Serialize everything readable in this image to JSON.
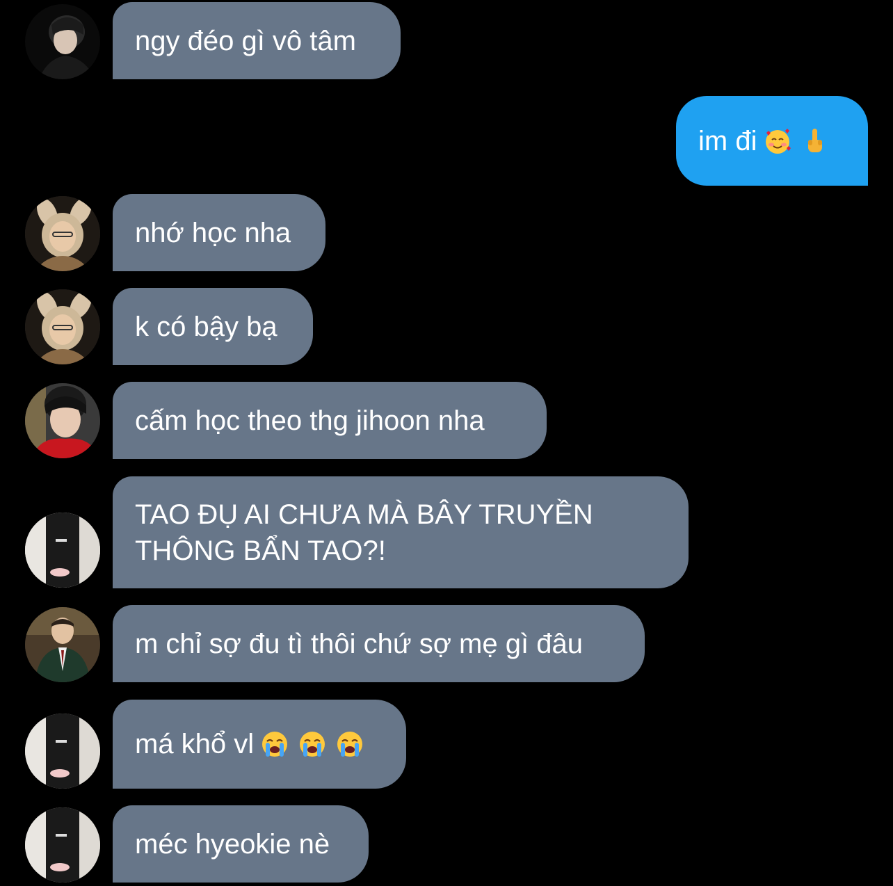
{
  "colors": {
    "background": "#000000",
    "incoming_bubble": "#677689",
    "outgoing_bubble": "#1fa1f1",
    "text": "#ffffff"
  },
  "messages": [
    {
      "direction": "in",
      "avatar": "avatar-glasses-profile",
      "text": "ngy đéo gì vô tâm"
    },
    {
      "direction": "out",
      "text": "im đi",
      "emojis": [
        "smiling-face-with-hearts-emoji",
        "middle-finger-emoji"
      ]
    },
    {
      "direction": "in",
      "avatar": "avatar-bunny-ears",
      "text": "nhớ học nha"
    },
    {
      "direction": "in",
      "avatar": "avatar-bunny-ears",
      "text": "k có bậy bạ"
    },
    {
      "direction": "in",
      "avatar": "avatar-red-scarf",
      "text": "cấm học theo thg jihoon nha"
    },
    {
      "direction": "in",
      "avatar": "avatar-white-jacket",
      "lines": [
        "TAO ĐỤ AI CHƯA MÀ BÂY TRUYỀN",
        "THÔNG BẨN TAO?!"
      ]
    },
    {
      "direction": "in",
      "avatar": "avatar-school-uniform",
      "text": "m chỉ sợ đu tì thôi chứ sợ mẹ gì đâu"
    },
    {
      "direction": "in",
      "avatar": "avatar-white-jacket",
      "text": "má khổ vl",
      "emojis": [
        "loudly-crying-face-emoji",
        "loudly-crying-face-emoji",
        "loudly-crying-face-emoji"
      ]
    },
    {
      "direction": "in",
      "avatar": "avatar-white-jacket",
      "text": "méc hyeokie nè"
    }
  ]
}
